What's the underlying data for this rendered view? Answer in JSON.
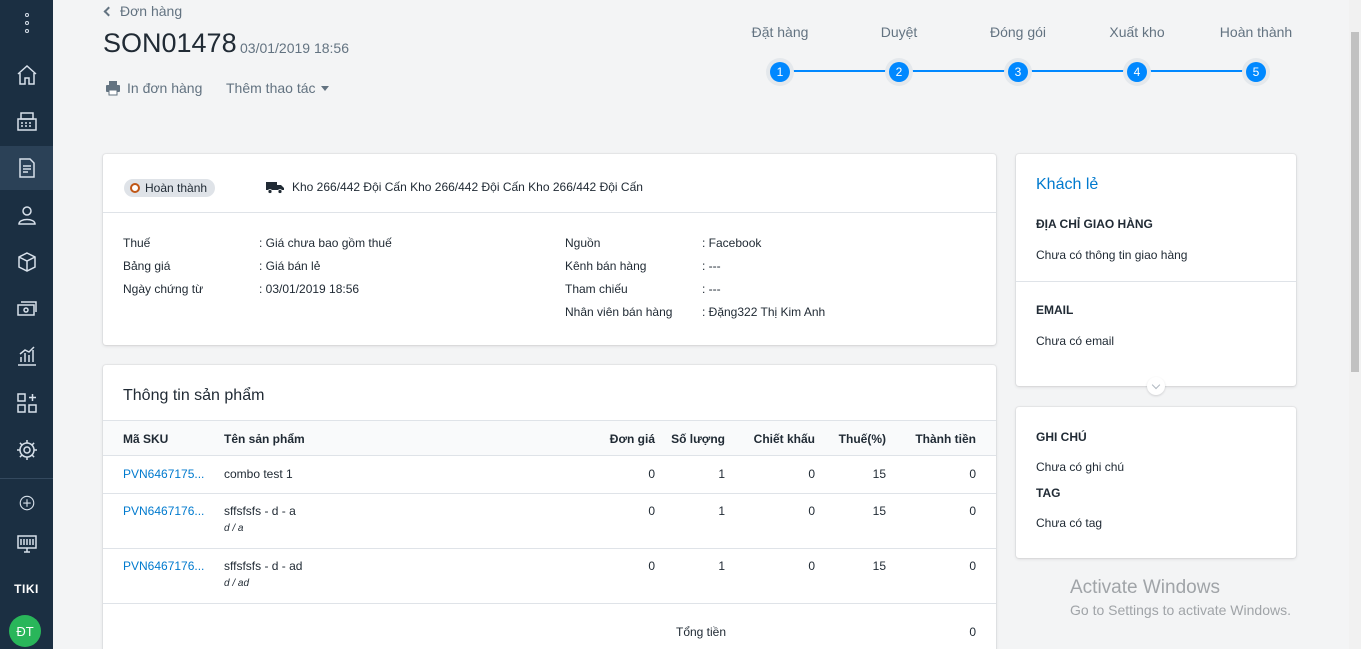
{
  "sidebar": {
    "items": [
      {
        "icon": "home-icon"
      },
      {
        "icon": "pos-register-icon"
      },
      {
        "icon": "order-document-icon",
        "active": true
      },
      {
        "icon": "customer-icon"
      },
      {
        "icon": "product-box-icon"
      },
      {
        "icon": "cash-money-icon"
      },
      {
        "icon": "report-chart-icon"
      },
      {
        "icon": "apps-grid-icon"
      },
      {
        "icon": "settings-gear-icon"
      }
    ],
    "lower_items": [
      {
        "icon": "add-channel-icon"
      },
      {
        "icon": "store-monitor-icon"
      }
    ],
    "channel_label": "TIKI",
    "avatar_initials": "ĐT"
  },
  "header": {
    "back_label": "Đơn hàng",
    "order_id": "SON01478",
    "order_date": "03/01/2019 18:56",
    "print_label": "In đơn hàng",
    "more_actions_label": "Thêm thao tác"
  },
  "stepper": {
    "steps": [
      {
        "label": "Đặt hàng",
        "number": "1"
      },
      {
        "label": "Duyệt",
        "number": "2"
      },
      {
        "label": "Đóng gói",
        "number": "3"
      },
      {
        "label": "Xuất kho",
        "number": "4"
      },
      {
        "label": "Hoàn thành",
        "number": "5"
      }
    ]
  },
  "info": {
    "status": "Hoàn thành",
    "warehouse": "Kho 266/442 Đội Cấn Kho 266/442 Đội Cấn Kho 266/442 Đội Cấn",
    "left": [
      {
        "label": "Thuế",
        "value": ": Giá chưa bao gồm thuế"
      },
      {
        "label": "Bảng giá",
        "value": ": Giá bán lẻ"
      },
      {
        "label": "Ngày chứng từ",
        "value": ": 03/01/2019 18:56"
      }
    ],
    "right": [
      {
        "label": "Nguồn",
        "value": ": Facebook"
      },
      {
        "label": "Kênh bán hàng",
        "value": ": ---"
      },
      {
        "label": "Tham chiếu",
        "value": ": ---"
      },
      {
        "label": "Nhân viên bán hàng",
        "value": ": Đặng322 Thị Kim Anh"
      }
    ]
  },
  "products": {
    "title": "Thông tin sản phẩm",
    "columns": [
      "Mã SKU",
      "Tên sản phẩm",
      "Đơn giá",
      "Số lượng",
      "Chiết khấu",
      "Thuế(%)",
      "Thành tiền"
    ],
    "rows": [
      {
        "sku": "PVN6467175...",
        "name": "combo test 1",
        "variant": "",
        "price": "0",
        "qty": "1",
        "discount": "0",
        "tax": "15",
        "total": "0"
      },
      {
        "sku": "PVN6467176...",
        "name": "sffsfsfs - d - a",
        "variant": "d / a",
        "price": "0",
        "qty": "1",
        "discount": "0",
        "tax": "15",
        "total": "0"
      },
      {
        "sku": "PVN6467176...",
        "name": "sffsfsfs - d - ad",
        "variant": "d / ad",
        "price": "0",
        "qty": "1",
        "discount": "0",
        "tax": "15",
        "total": "0"
      }
    ],
    "total_label": "Tổng tiền",
    "total_value": "0"
  },
  "customer": {
    "name": "Khách lẻ",
    "shipping_title": "ĐỊA CHỈ GIAO HÀNG",
    "shipping_value": "Chưa có thông tin giao hàng",
    "email_title": "EMAIL",
    "email_value": "Chưa có email"
  },
  "notes": {
    "note_title": "GHI CHÚ",
    "note_value": "Chưa có ghi chú",
    "tag_title": "TAG",
    "tag_value": "Chưa có tag"
  },
  "watermark": {
    "line1": "Activate Windows",
    "line2": "Go to Settings to activate Windows."
  },
  "colors": {
    "sidebar_bg": "#1b2f42",
    "accent_blue": "#0088ff",
    "link_blue": "#007ace",
    "avatar_green": "#29b65a",
    "status_ring": "#c05717"
  }
}
